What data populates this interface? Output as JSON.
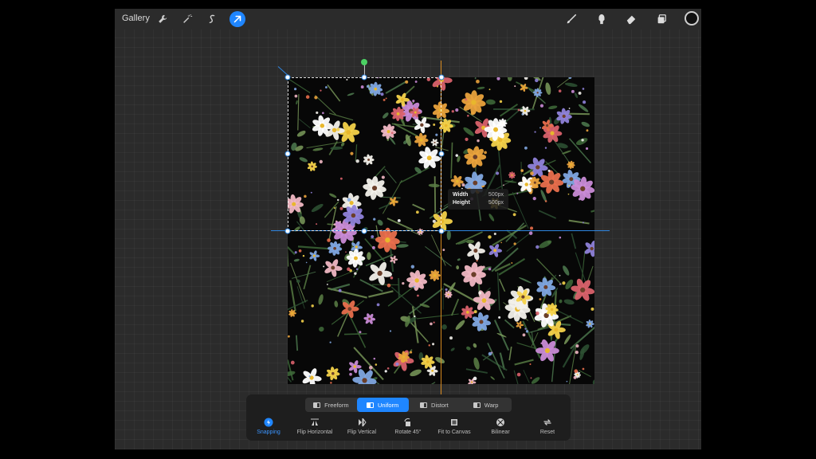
{
  "topbar": {
    "gallery_label": "Gallery",
    "left_icons": [
      "wrench-icon",
      "magic-wand-icon",
      "selection-s-icon",
      "transform-arrow-icon"
    ],
    "right_icons": [
      "brush-icon",
      "smudge-icon",
      "eraser-icon",
      "layers-icon"
    ],
    "current_color": "#111111"
  },
  "transform_info": {
    "width_label": "Width",
    "width_value": "500px",
    "height_label": "Height",
    "height_value": "500px"
  },
  "modes": [
    {
      "label": "Freeform",
      "active": false
    },
    {
      "label": "Uniform",
      "active": true
    },
    {
      "label": "Distort",
      "active": false
    },
    {
      "label": "Warp",
      "active": false
    }
  ],
  "actions": [
    {
      "label": "Snapping",
      "icon": "snapping-icon",
      "active": true
    },
    {
      "label": "Flip Horizontal",
      "icon": "flip-horizontal-icon",
      "active": false
    },
    {
      "label": "Flip Vertical",
      "icon": "flip-vertical-icon",
      "active": false
    },
    {
      "label": "Rotate 45°",
      "icon": "rotate-icon",
      "active": false
    },
    {
      "label": "Fit to Canvas",
      "icon": "fit-to-canvas-icon",
      "active": false
    },
    {
      "label": "Bilinear",
      "icon": "bilinear-icon",
      "active": false
    },
    {
      "label": "Reset",
      "icon": "reset-icon",
      "active": false
    }
  ],
  "colors": {
    "accent": "#1f86ff",
    "guide_vertical": "#d88a1f",
    "guide_horizontal": "#2f86e0",
    "rotation_handle": "#4bd163"
  }
}
